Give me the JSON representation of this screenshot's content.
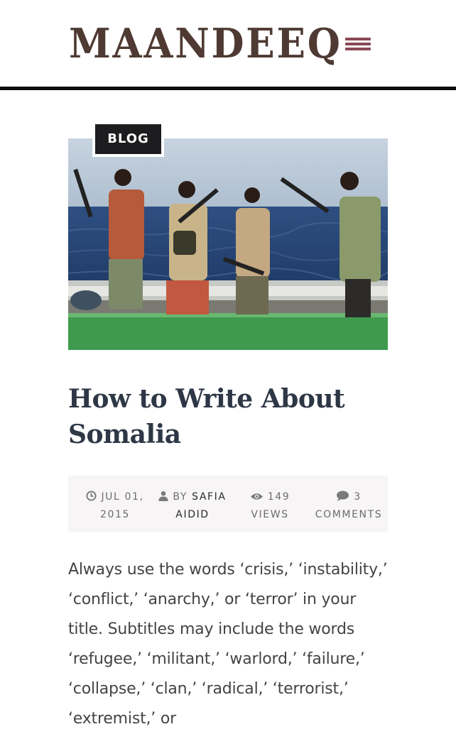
{
  "header": {
    "logo_text": "MAANDEEQ",
    "menu_icon": "hamburger-icon",
    "accent_color": "#8a4858"
  },
  "article": {
    "category": "BLOG",
    "hero_image": "photo of four armed men standing on a green boat at sea",
    "title": "How to Write About Somalia",
    "meta": {
      "date_line1": "JUL 01,",
      "date_line2": "2015",
      "by_label": "BY",
      "author_line1": "SAFIA",
      "author_line2": "AIDID",
      "views_count": "149",
      "views_label": "VIEWS",
      "comments_count": "3",
      "comments_label": "COMMENTS",
      "icons": [
        "clock-icon",
        "user-icon",
        "eye-icon",
        "comment-icon"
      ]
    },
    "body": "Always use the words ‘crisis,’ ‘instability,’ ‘conflict,’ ‘anarchy,’ or ‘terror’ in your title. Subtitles may include the words ‘refugee,’ ‘militant,’ ‘warlord,’ ‘failure,’ ‘collapse,’ ‘clan,’ ‘radical,’ ‘terrorist,’ ‘extremist,’ or"
  }
}
